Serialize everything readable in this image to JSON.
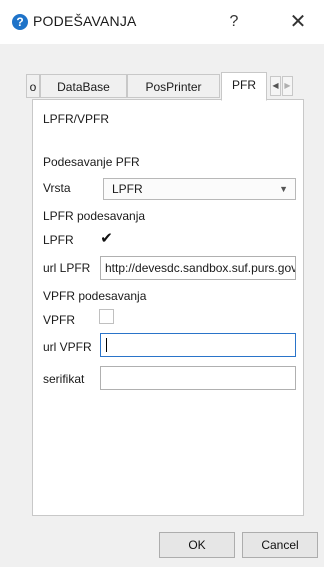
{
  "window": {
    "title": "PODEŠAVANJA",
    "help_symbol": "?",
    "close_symbol": "✕",
    "icon": "question-circle-icon"
  },
  "tabs": [
    {
      "label": "o"
    },
    {
      "label": "DataBase"
    },
    {
      "label": "PosPrinter"
    },
    {
      "label": "PFR",
      "active": true
    }
  ],
  "tab_scroll": {
    "left": "◀",
    "right": "▶"
  },
  "panel": {
    "group_title": "LPFR/VPFR",
    "pfr_section": "Podesavanje PFR",
    "vrsta_label": "Vrsta",
    "vrsta_value": "LPFR",
    "vrsta_arrow": "▼",
    "lpfr_section": "LPFR podesavanja",
    "lpfr_label": "LPFR",
    "lpfr_checked": true,
    "check_glyph": "✔",
    "url_lpfr_label": "url LPFR",
    "url_lpfr_value": "http://devesdc.sandbox.suf.purs.gov.rs",
    "vpfr_section": "VPFR podesavanja",
    "vpfr_label": "VPFR",
    "vpfr_checked": false,
    "url_vpfr_label": "url VPFR",
    "url_vpfr_value": "",
    "serifikat_label": "serifikat",
    "serifikat_value": ""
  },
  "buttons": {
    "ok": "OK",
    "cancel": "Cancel"
  },
  "colors": {
    "accent": "#1e73c9",
    "focus_border": "#2a74c9"
  }
}
